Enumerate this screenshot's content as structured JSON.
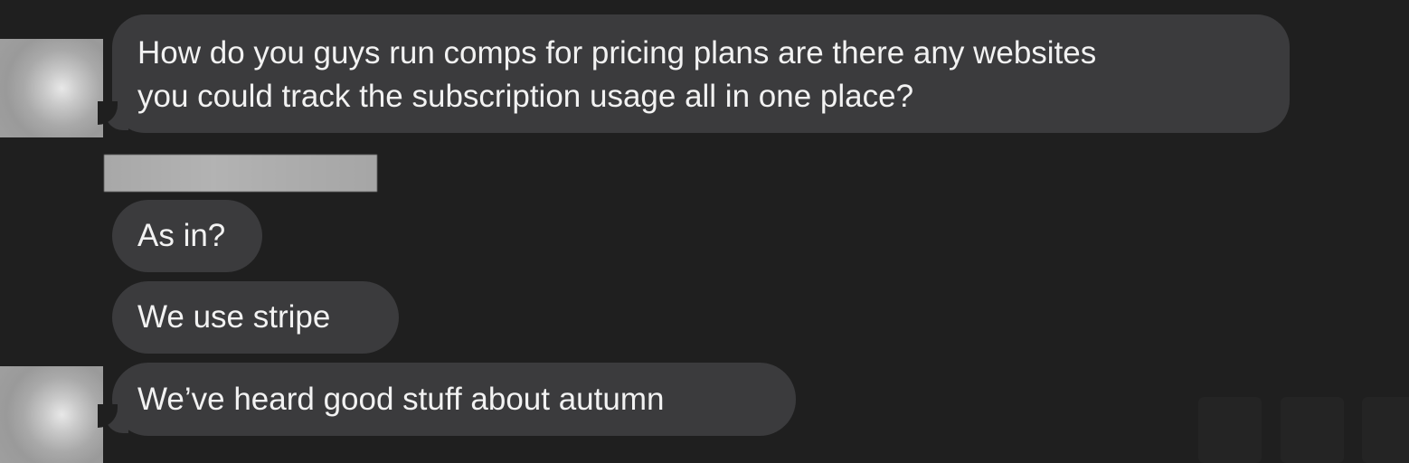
{
  "messages": [
    {
      "lines": [
        "How do you guys run comps for pricing plans are there any websites",
        "you could track the subscription usage all in one place?"
      ]
    },
    {
      "text": "As in?"
    },
    {
      "text": "We use stripe"
    },
    {
      "text": "We’ve heard good stuff about autumn"
    }
  ],
  "colors": {
    "background": "#1f1f1f",
    "bubble": "#3b3b3d",
    "text": "#f2f2f2"
  }
}
